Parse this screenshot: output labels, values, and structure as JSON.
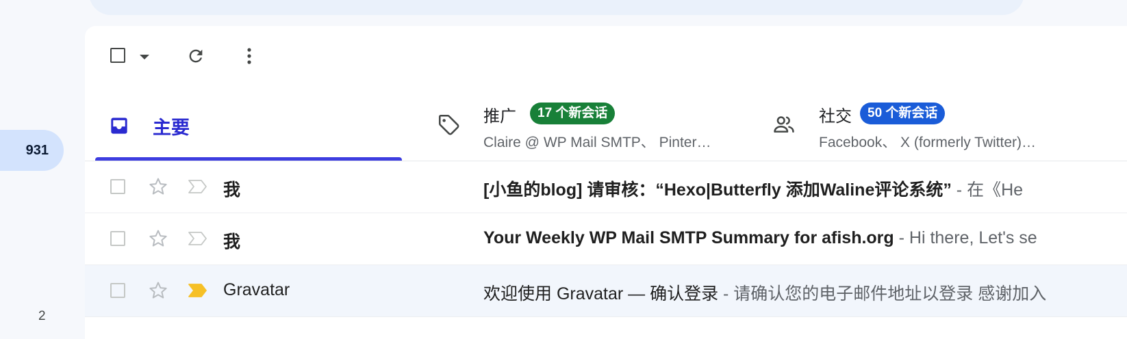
{
  "sidebar": {
    "unread_count": "931",
    "second_count": "2"
  },
  "toolbar": {
    "select_icon": "checkbox-icon",
    "select_menu_icon": "caret-down-icon",
    "refresh_icon": "refresh-icon",
    "more_icon": "more-vert-icon"
  },
  "tabs": {
    "primary": {
      "label": "主要",
      "icon": "inbox-icon"
    },
    "promotions": {
      "title": "推广",
      "badge": "17 个新会话",
      "badge_color": "#188038",
      "sub": "Claire @ WP Mail SMTP、 Pinter…",
      "icon": "tag-icon"
    },
    "social": {
      "title": "社交",
      "badge": "50 个新会话",
      "badge_color": "#1a5cd8",
      "sub": "Facebook、 X (formerly Twitter)…",
      "icon": "people-icon"
    }
  },
  "emails": [
    {
      "sender": "我",
      "subject": "[小鱼的blog] 请审核：“Hexo|Butterfly 添加Waline评论系统”",
      "snippet": " - 在《He",
      "unread": true,
      "important": false
    },
    {
      "sender": "我",
      "subject": "Your Weekly WP Mail SMTP Summary for afish.org",
      "snippet": " - Hi there, Let's se",
      "unread": true,
      "important": false
    },
    {
      "sender": "Gravatar",
      "subject": "欢迎使用 Gravatar — 确认登录",
      "snippet": " - 请确认您的电子邮件地址以登录 感谢加入",
      "unread": false,
      "important": true
    }
  ],
  "colors": {
    "accent": "#3d3de0",
    "important_marker": "#f6c026"
  }
}
